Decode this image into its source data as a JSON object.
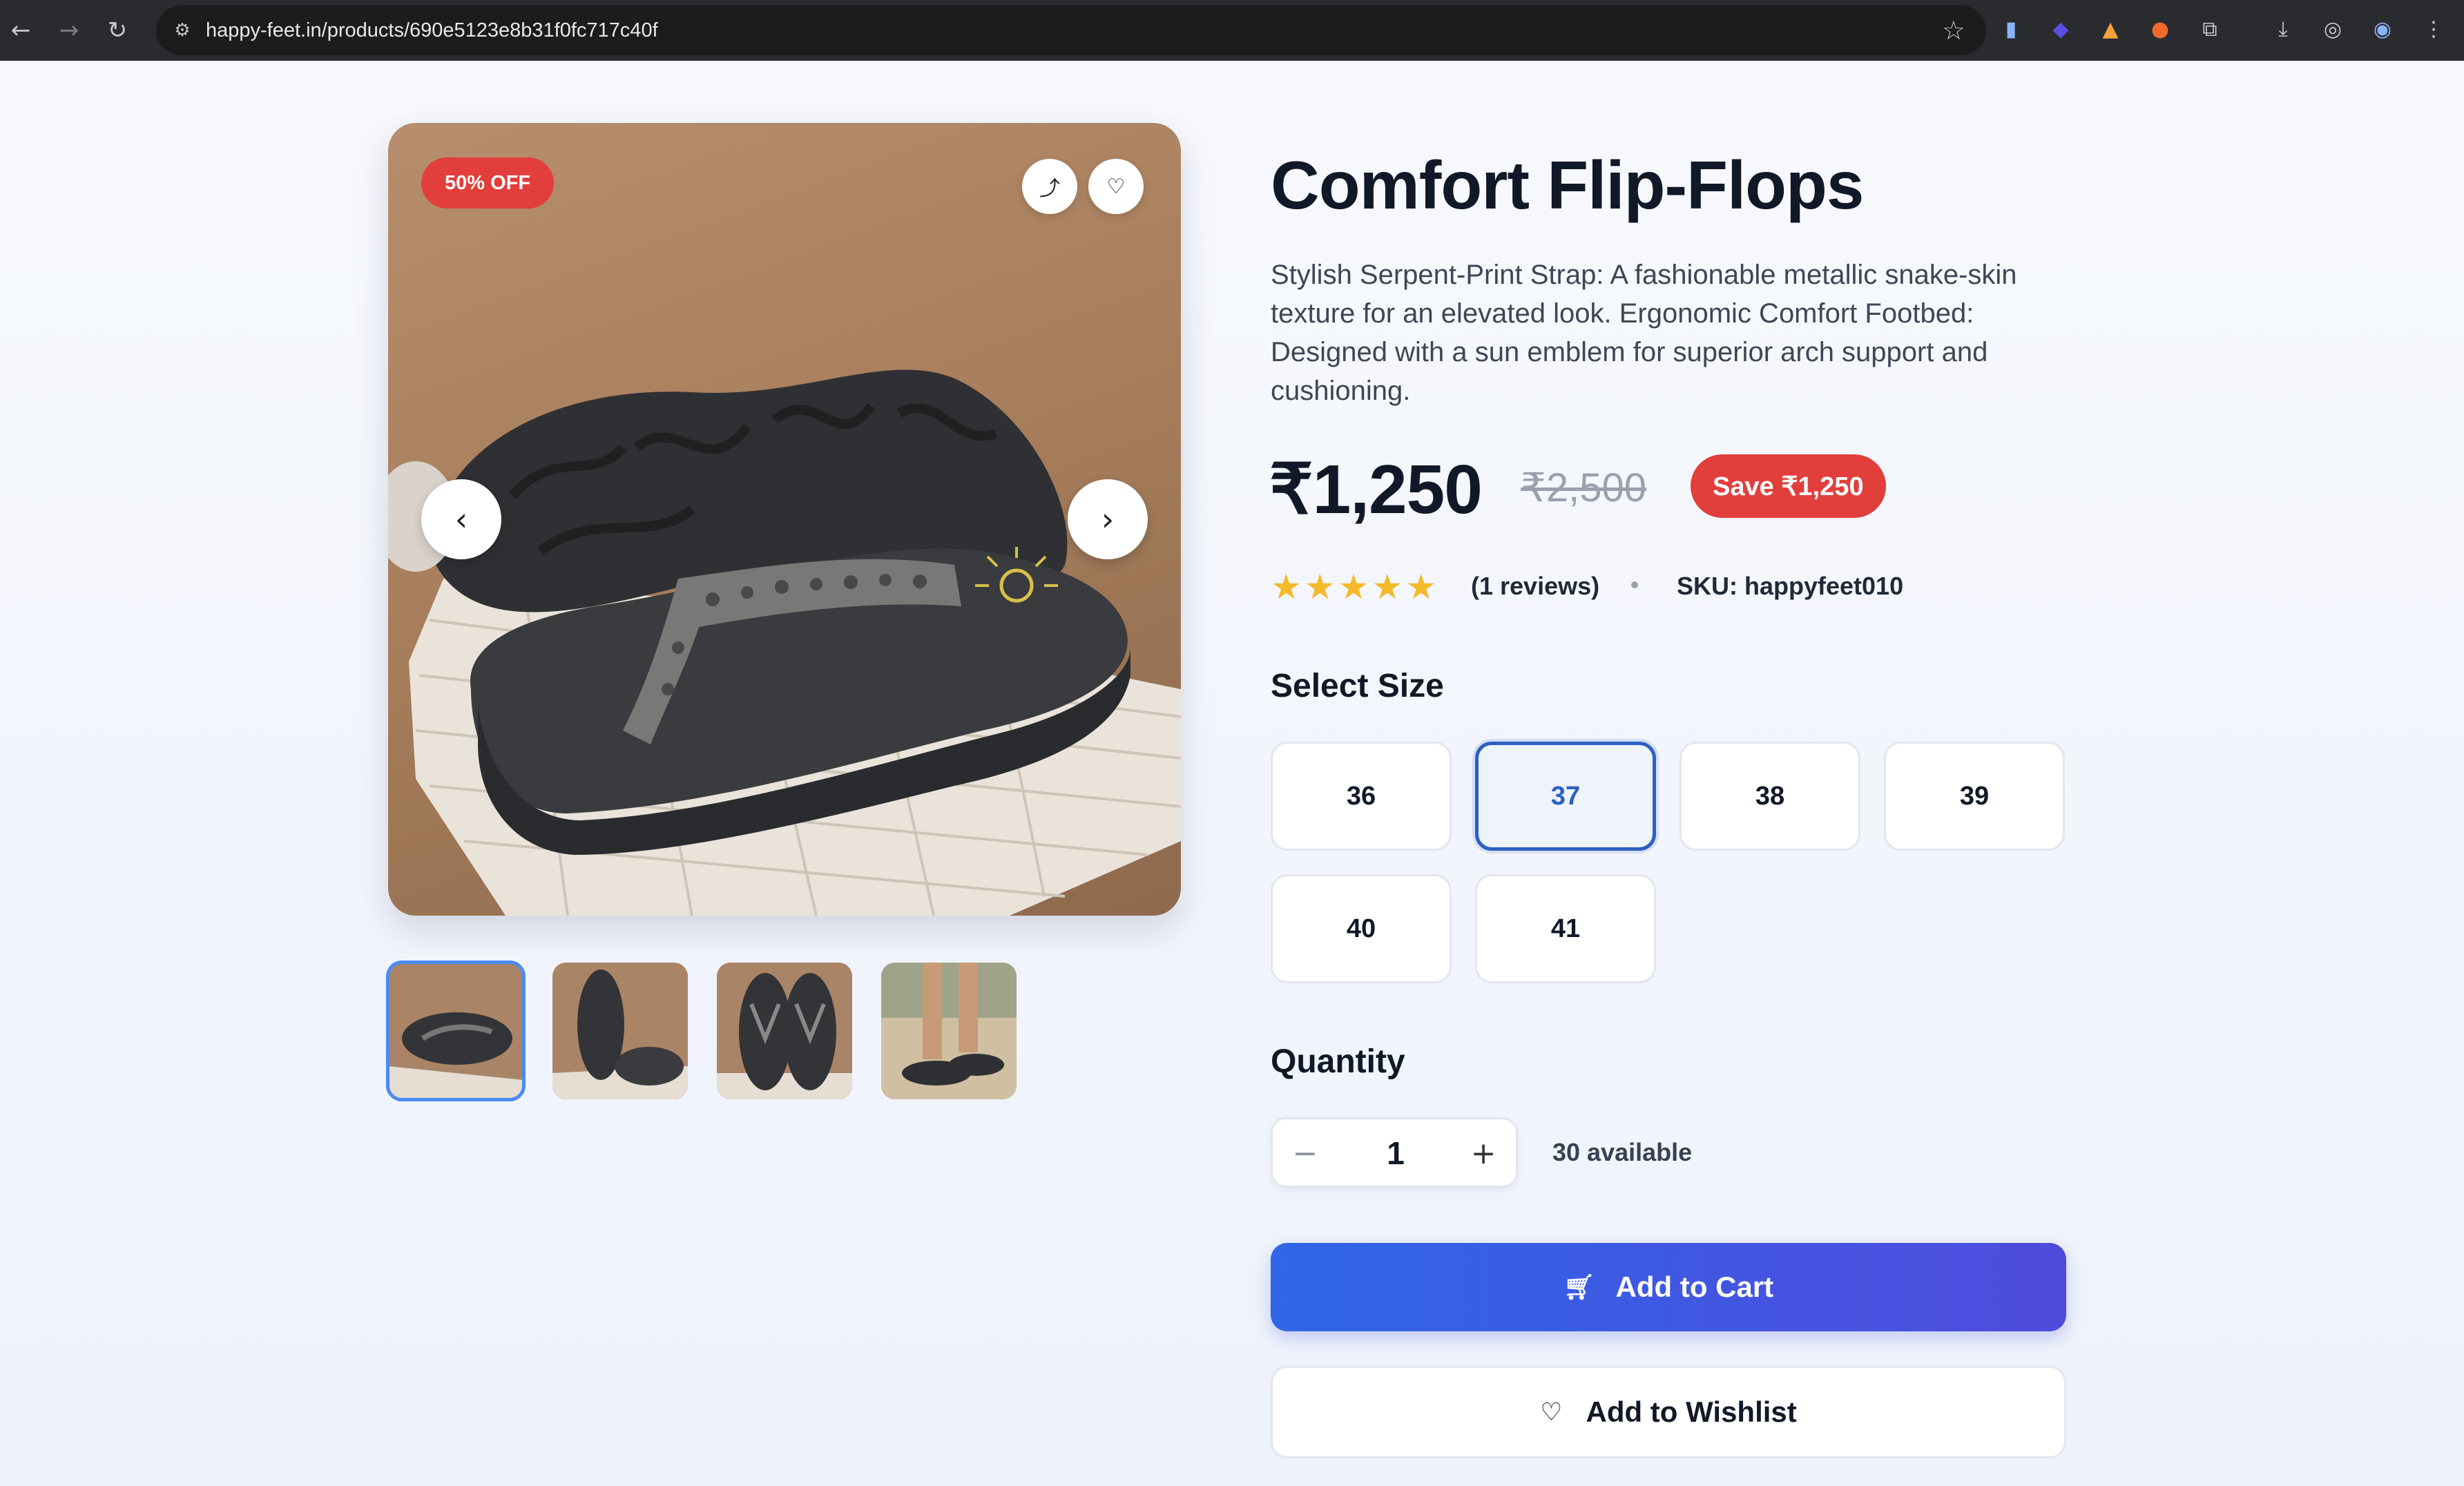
{
  "browser": {
    "url": "happy-feet.in/products/690e5123e8b31f0fc717c40f"
  },
  "gallery": {
    "discount_badge": "50% OFF",
    "thumbnail_count": 4,
    "active_thumbnail": 1
  },
  "product": {
    "title": "Comfort Flip-Flops",
    "description": "Stylish Serpent-Print Strap: A fashionable metallic snake-skin texture for an elevated look. Ergonomic Comfort Footbed: Designed with a sun emblem for superior arch support and cushioning.",
    "price": "₹1,250",
    "original_price": "₹2,500",
    "save_label": "Save ₹1,250",
    "rating": 5,
    "reviews_text": "(1 reviews)",
    "sku_text": "SKU: happyfeet010"
  },
  "size": {
    "label": "Select Size",
    "options": [
      "36",
      "37",
      "38",
      "39",
      "40",
      "41"
    ],
    "selected": "37"
  },
  "quantity": {
    "label": "Quantity",
    "value": "1",
    "available_text": "30 available"
  },
  "actions": {
    "add_to_cart": "Add to Cart",
    "add_to_wishlist": "Add to Wishlist"
  },
  "colors": {
    "accent": "#2f66e8",
    "sale_red": "#e23e3b",
    "star": "#f5b92a"
  }
}
